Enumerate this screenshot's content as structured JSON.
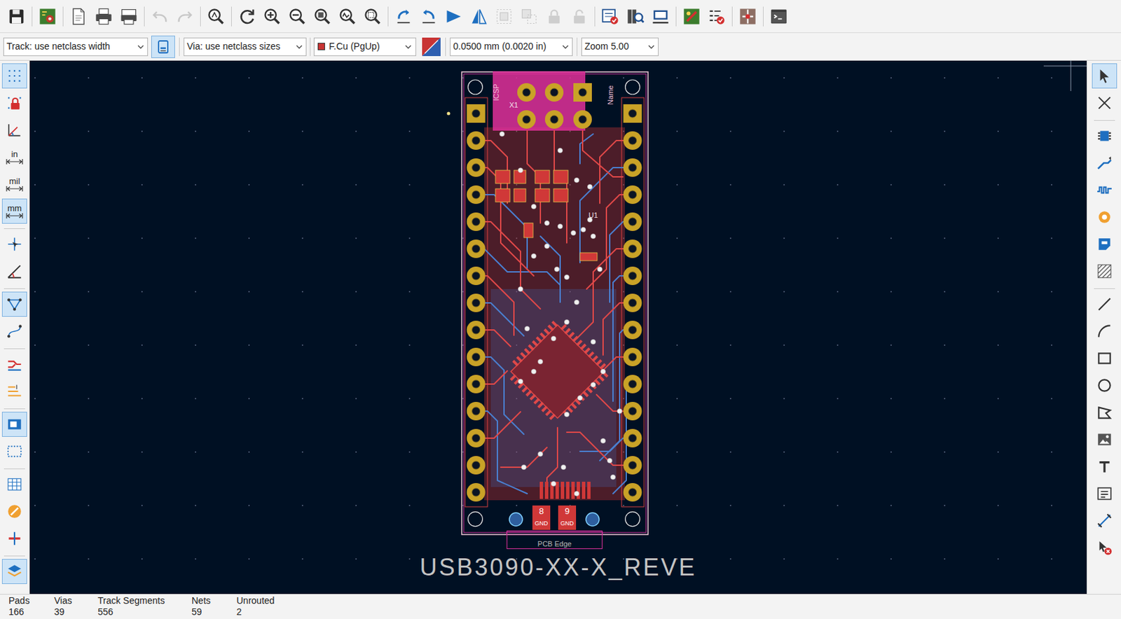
{
  "top_toolbar": [
    {
      "disabled": false
    },
    {
      "disabled": false
    },
    {
      "disabled": false
    },
    {
      "disabled": false
    },
    {
      "disabled": false
    },
    {
      "disabled": true
    },
    {
      "disabled": true
    },
    {
      "disabled": false
    },
    {
      "disabled": false
    },
    {
      "disabled": false
    },
    {
      "disabled": false
    },
    {
      "disabled": false
    },
    {
      "disabled": false
    },
    {
      "disabled": false
    },
    {
      "disabled": false
    },
    {
      "disabled": false
    },
    {
      "disabled": false
    },
    {
      "disabled": false
    },
    {
      "disabled": true
    },
    {
      "disabled": true
    },
    {
      "disabled": true
    },
    {
      "disabled": true
    },
    {
      "disabled": false
    },
    {
      "disabled": false
    },
    {
      "disabled": false
    },
    {
      "disabled": false
    },
    {
      "disabled": false
    },
    {
      "disabled": false
    },
    {
      "disabled": false
    }
  ],
  "options_bar": {
    "track_width": "Track: use netclass width",
    "auto_width": {
      "selected": true
    },
    "via_size": "Via: use netclass sizes",
    "layer": "F.Cu (PgUp)",
    "grid": "0.0500 mm (0.0020 in)",
    "zoom": "Zoom 5.00"
  },
  "left_toolbar": [
    {
      "kind": "icon",
      "selected": true
    },
    {
      "kind": "icon",
      "selected": false
    },
    {
      "kind": "icon",
      "selected": false
    },
    {
      "kind": "unit",
      "label": "in",
      "selected": false
    },
    {
      "kind": "unit",
      "label": "mil",
      "selected": false
    },
    {
      "kind": "unit",
      "label": "mm",
      "selected": true
    },
    {
      "kind": "icon",
      "selected": false
    },
    {
      "kind": "icon",
      "selected": false
    },
    {
      "kind": "icon",
      "selected": true
    },
    {
      "kind": "icon",
      "selected": false
    },
    {
      "kind": "icon",
      "selected": false
    },
    {
      "kind": "icon",
      "selected": false
    },
    {
      "kind": "icon",
      "selected": true
    },
    {
      "kind": "icon",
      "selected": false
    },
    {
      "kind": "icon",
      "selected": false
    },
    {
      "kind": "icon",
      "selected": false
    },
    {
      "kind": "icon",
      "selected": false
    },
    {
      "kind": "icon",
      "selected": true
    }
  ],
  "right_toolbar": [
    {
      "selected": true
    },
    {
      "selected": false
    },
    {
      "selected": false
    },
    {
      "selected": false
    },
    {
      "selected": false
    },
    {
      "selected": false
    },
    {
      "selected": false
    },
    {
      "selected": false
    },
    {
      "selected": false
    },
    {
      "selected": false
    },
    {
      "selected": false
    },
    {
      "selected": false
    },
    {
      "selected": false
    },
    {
      "selected": false
    },
    {
      "selected": false
    },
    {
      "selected": false
    },
    {
      "selected": false
    },
    {
      "selected": false
    }
  ],
  "board": {
    "title": "USB3090-XX-X_REVE",
    "edge_label": "PCB Edge",
    "silkscreen": [
      {
        "text": "X1"
      },
      {
        "text": "U1"
      },
      {
        "text": "Name"
      },
      {
        "text": "ICSP"
      }
    ],
    "connector_pads": [
      {
        "number": "8",
        "net": "GND"
      },
      {
        "number": "9",
        "net": "GND"
      }
    ]
  },
  "status_bar": [
    {
      "label": "Pads",
      "value": "166"
    },
    {
      "label": "Vias",
      "value": "39"
    },
    {
      "label": "Track Segments",
      "value": "556"
    },
    {
      "label": "Nets",
      "value": "59"
    },
    {
      "label": "Unrouted",
      "value": "2"
    }
  ]
}
